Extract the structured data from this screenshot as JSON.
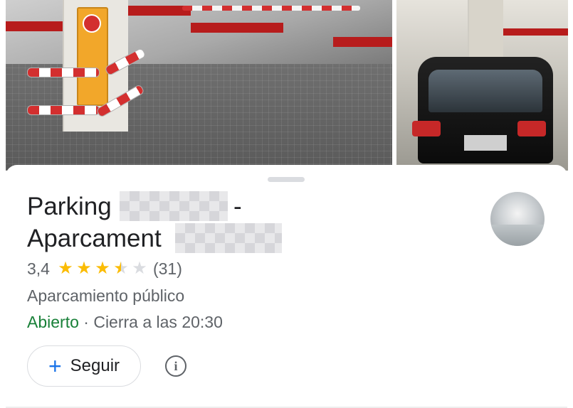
{
  "place": {
    "name_line1": "Parking",
    "name_dash": "-",
    "name_line2": "Aparcament",
    "rating": "3,4",
    "stars": 3.5,
    "review_count": "(31)",
    "category": "Aparcamiento público",
    "status": "Abierto",
    "hours_separator": " · ",
    "closing": "Cierra a las 20:30"
  },
  "actions": {
    "follow_plus": "+",
    "follow_label": "Seguir",
    "info_glyph": "i"
  },
  "colors": {
    "star": "#fbbc04",
    "open": "#188038",
    "accent": "#1a73e8"
  }
}
